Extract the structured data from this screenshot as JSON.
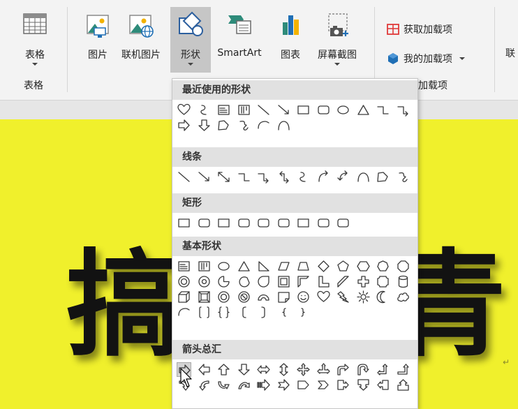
{
  "ribbon": {
    "table": {
      "label": "表格",
      "group_label": "表格"
    },
    "picture": {
      "label": "图片"
    },
    "online_picture": {
      "label": "联机图片"
    },
    "shapes": {
      "label": "形状"
    },
    "smartart": {
      "label": "SmartArt"
    },
    "chart": {
      "label": "图表"
    },
    "screenshot": {
      "label": "屏幕截图"
    },
    "addins": {
      "get_label": "获取加载项",
      "my_label": "我的加载项",
      "group_label_partial": "加载项"
    },
    "truncated_right_label": "联"
  },
  "gallery": {
    "recent": {
      "title": "最近使用的形状",
      "count": 20
    },
    "lines": {
      "title": "线条",
      "count": 12
    },
    "rectangles": {
      "title": "矩形",
      "count": 9
    },
    "basic": {
      "title": "基本形状",
      "count": 42
    },
    "arrows": {
      "title": "箭头总汇",
      "count": 26
    }
  },
  "slide": {
    "char_left": "搞",
    "char_right": "青",
    "paragraph_mark": "↵"
  },
  "colors": {
    "slide_background": "#f0f02c",
    "ribbon_background": "#f3f3f3",
    "active_button": "#c6c6c6",
    "addin_red": "#e03a3a",
    "addin_blue": "#1f6fb5",
    "icon_teal": "#2e8b7a"
  }
}
